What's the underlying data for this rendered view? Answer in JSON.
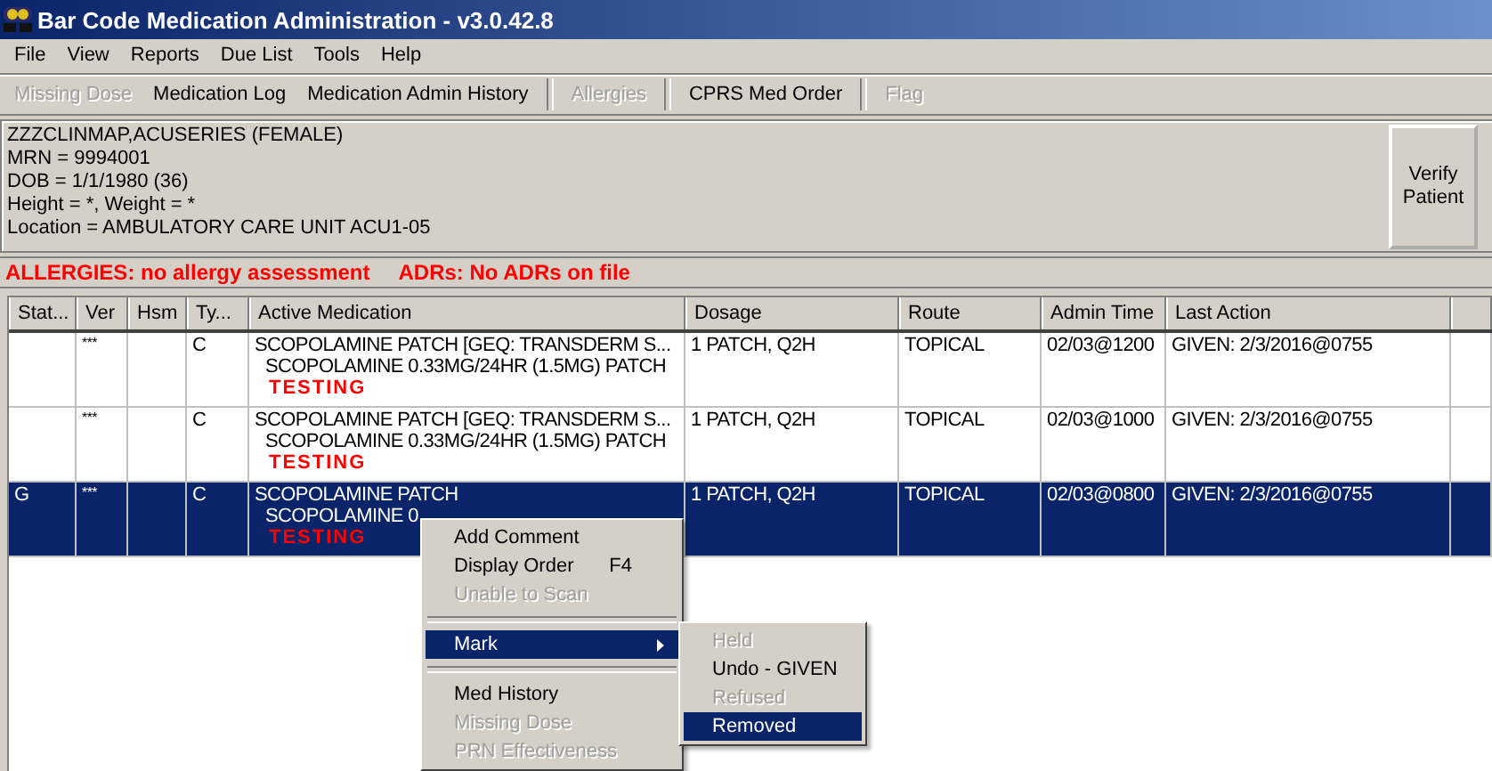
{
  "window": {
    "title": "Bar Code Medication Administration - v3.0.42.8"
  },
  "menu_bar": [
    "File",
    "View",
    "Reports",
    "Due List",
    "Tools",
    "Help"
  ],
  "toolbar": [
    {
      "label": "Missing Dose",
      "disabled": true,
      "separator_after": false
    },
    {
      "label": "Medication Log",
      "disabled": false,
      "separator_after": false
    },
    {
      "label": "Medication Admin History",
      "disabled": false,
      "separator_after": true
    },
    {
      "label": "Allergies",
      "disabled": true,
      "separator_after": true
    },
    {
      "label": "CPRS Med Order",
      "disabled": false,
      "separator_after": true
    },
    {
      "label": "Flag",
      "disabled": true,
      "separator_after": false
    }
  ],
  "patient": {
    "lines": [
      "ZZZCLINMAP,ACUSERIES  (FEMALE)",
      "MRN = 9994001",
      "DOB = 1/1/1980 (36)",
      "Height = *, Weight = *",
      "Location = AMBULATORY CARE UNIT ACU1-05"
    ],
    "verify_button": [
      "Verify",
      "Patient"
    ]
  },
  "alert_bar": [
    "ALLERGIES: no allergy assessment",
    "ADRs: No ADRs on file"
  ],
  "table": {
    "columns": [
      "Stat...",
      "Ver",
      "Hsm",
      "Ty...",
      "Active Medication",
      "Dosage",
      "Route",
      "Admin Time",
      "Last Action"
    ],
    "rows": [
      {
        "selected": false,
        "status": "",
        "ver": "***",
        "type": "C",
        "medication": [
          "SCOPOLAMINE PATCH [GEQ: TRANSDERM S...",
          "SCOPOLAMINE 0.33MG/24HR (1.5MG) PATCH"
        ],
        "note": "TESTING",
        "dosage": "1 PATCH, Q2H",
        "route": "TOPICAL",
        "admin_time": "02/03@1200",
        "last_action": "GIVEN: 2/3/2016@0755"
      },
      {
        "selected": false,
        "status": "",
        "ver": "***",
        "type": "C",
        "medication": [
          "SCOPOLAMINE PATCH [GEQ: TRANSDERM S...",
          "SCOPOLAMINE 0.33MG/24HR (1.5MG) PATCH"
        ],
        "note": "TESTING",
        "dosage": "1 PATCH, Q2H",
        "route": "TOPICAL",
        "admin_time": "02/03@1000",
        "last_action": "GIVEN: 2/3/2016@0755"
      },
      {
        "selected": true,
        "status": "G",
        "ver": "***",
        "type": "C",
        "medication": [
          "SCOPOLAMINE PATCH",
          "SCOPOLAMINE 0"
        ],
        "note": "TESTING",
        "dosage": "1 PATCH, Q2H",
        "route": "TOPICAL",
        "admin_time": "02/03@0800",
        "last_action": "GIVEN: 2/3/2016@0755"
      }
    ]
  },
  "context_menu": {
    "items": [
      {
        "kind": "item",
        "label": "Add Comment",
        "disabled": false,
        "selected": false
      },
      {
        "kind": "item",
        "label": "Display Order",
        "shortcut": "F4",
        "disabled": false,
        "selected": false
      },
      {
        "kind": "item",
        "label": "Unable to Scan",
        "disabled": true,
        "selected": false
      },
      {
        "kind": "separator"
      },
      {
        "kind": "submenu",
        "label": "Mark",
        "disabled": false,
        "selected": true
      },
      {
        "kind": "separator"
      },
      {
        "kind": "item",
        "label": "Med History",
        "disabled": false,
        "selected": false
      },
      {
        "kind": "item",
        "label": "Missing Dose",
        "disabled": true,
        "selected": false
      },
      {
        "kind": "item",
        "label": "PRN Effectiveness",
        "disabled": true,
        "selected": false
      }
    ],
    "submenu": [
      {
        "label": "Held",
        "disabled": true,
        "selected": false
      },
      {
        "label": "Undo - GIVEN",
        "disabled": false,
        "selected": false
      },
      {
        "label": "Refused",
        "disabled": true,
        "selected": false
      },
      {
        "label": "Removed",
        "disabled": false,
        "selected": true
      }
    ]
  }
}
